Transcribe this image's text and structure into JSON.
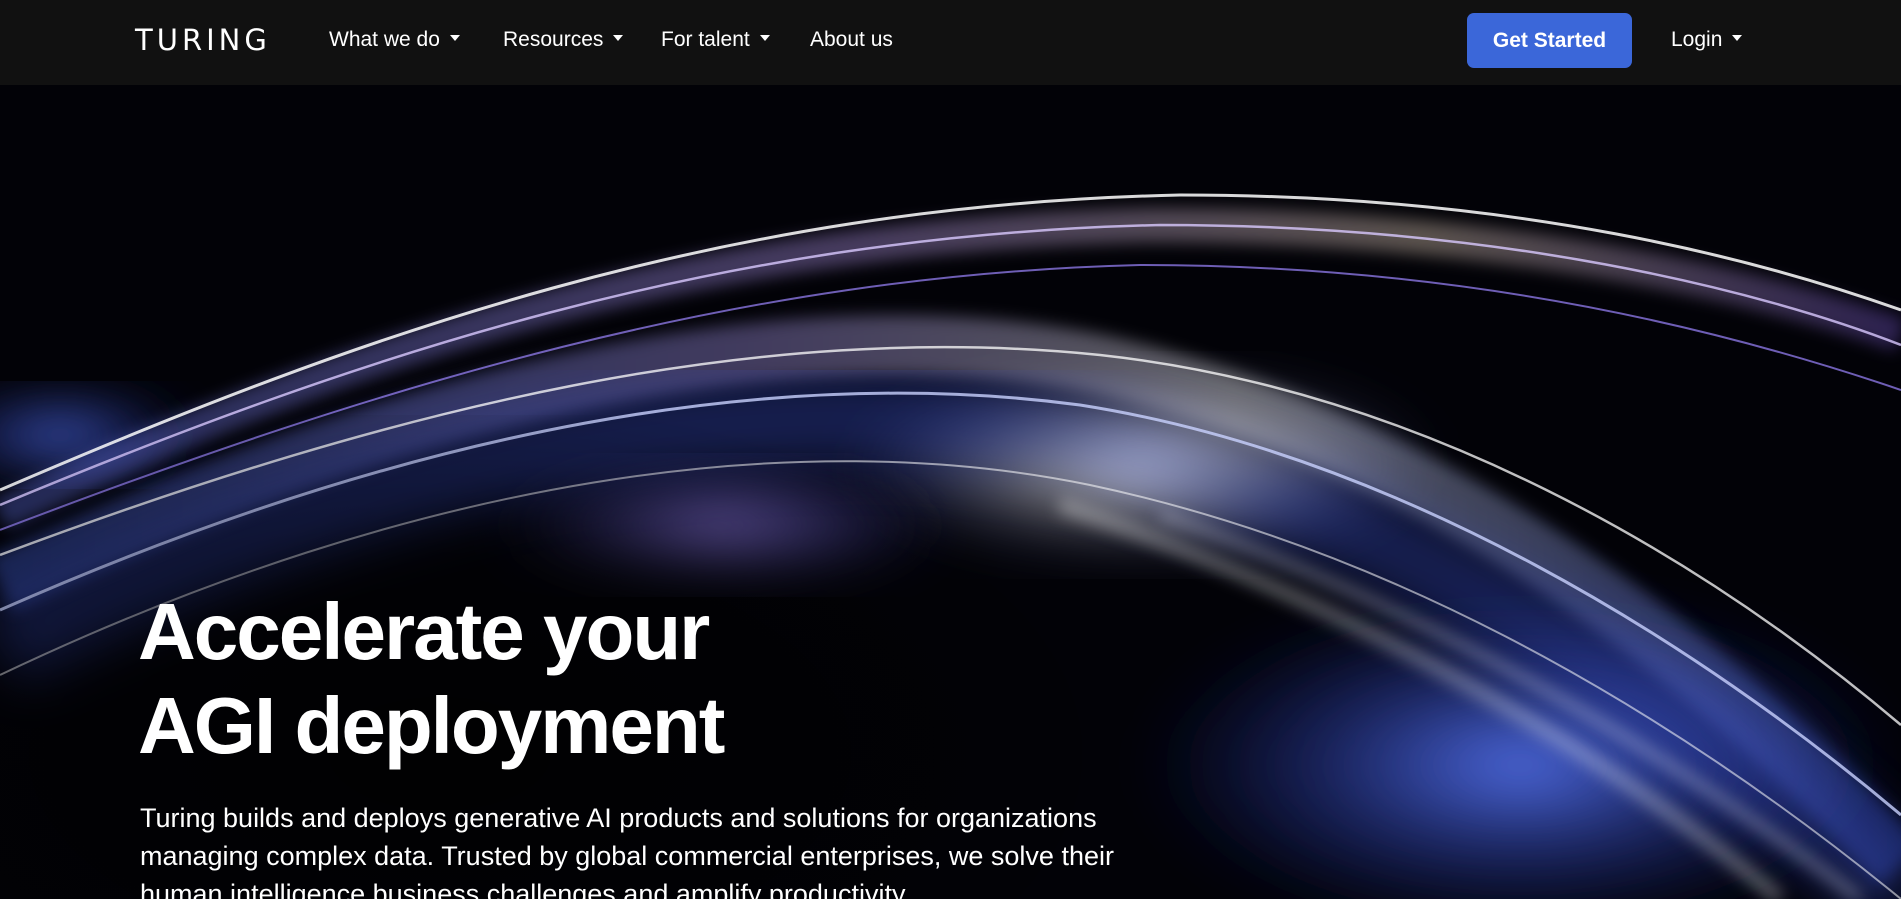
{
  "brand": {
    "logo_text": "TURING"
  },
  "nav": {
    "items": [
      {
        "label": "What we do",
        "has_dropdown": true
      },
      {
        "label": "Resources",
        "has_dropdown": true
      },
      {
        "label": "For talent",
        "has_dropdown": true
      },
      {
        "label": "About us",
        "has_dropdown": false
      }
    ],
    "cta_label": "Get Started",
    "login_label": "Login"
  },
  "hero": {
    "headline_line1": "Accelerate your",
    "headline_line2": "AGI deployment",
    "description": "Turing builds and deploys generative AI products and solutions for organizations managing complex data. Trusted by global commercial enterprises, we solve their human intelligence business challenges and amplify productivity."
  },
  "colors": {
    "nav_background": "#111111",
    "cta_background": "#3b67d9",
    "hero_background": "#020207",
    "text": "#ffffff"
  },
  "icons": [
    "chevron-down-icon"
  ]
}
